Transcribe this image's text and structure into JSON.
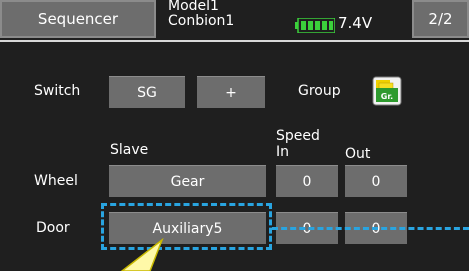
{
  "header": {
    "title": "Sequencer",
    "model_name": "Model1",
    "model_type": "Conbion1",
    "battery_voltage": "7.4V",
    "page": "2/2"
  },
  "switch_row": {
    "label": "Switch",
    "switch_value": "SG",
    "mode_value": "+",
    "group_label": "Group",
    "group_icon_text": "Gr."
  },
  "columns": {
    "slave": "Slave",
    "speed": "Speed",
    "in": "In",
    "out": "Out"
  },
  "rows": [
    {
      "label": "Wheel",
      "slave": "Gear",
      "speed_in": "0",
      "speed_out": "0"
    },
    {
      "label": "Door",
      "slave": "Auxiliary5",
      "speed_in": "0",
      "speed_out": "0"
    }
  ],
  "colors": {
    "background": "#1f1f1f",
    "button": "#6d6d6d",
    "highlight": "#29a4e0",
    "callout": "#fff9a8",
    "battery": "#3bd13b"
  }
}
